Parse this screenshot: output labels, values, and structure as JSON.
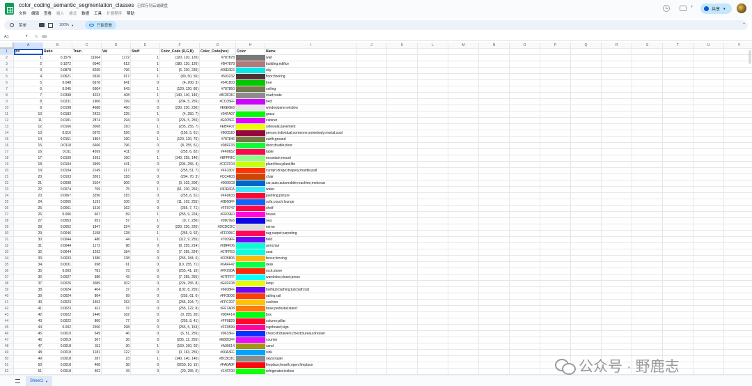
{
  "doc": {
    "title": "color_coding_semantic_segmentation_classes",
    "saved": "已保存到云端硬盘",
    "menus": [
      "文件",
      "编辑",
      "查看",
      "插入",
      "格式",
      "数据",
      "工具",
      "扩展程序",
      "帮助"
    ]
  },
  "toolbar": {
    "search": "菜单",
    "zoom": "100%",
    "view_mode": "只能查看",
    "share": "共享"
  },
  "formula": {
    "cell_ref": "A1",
    "value": "Idx"
  },
  "columns": [
    "A",
    "B",
    "C",
    "D",
    "E",
    "F",
    "G",
    "H",
    "I",
    "J",
    "K",
    "L",
    "M",
    "N",
    "O",
    "P",
    "Q",
    "R",
    "S",
    "T",
    "U",
    "V"
  ],
  "headers": [
    "Idx",
    "Ratio",
    "Train",
    "Val",
    "Stuff",
    "Color_Code (R,G,B)",
    "Color_Code(hex)",
    "Color",
    "Name"
  ],
  "rows": [
    [
      "1",
      "0.1576",
      "11664",
      "1172",
      "1",
      "(120, 120, 120)",
      "#787878",
      "#787878",
      "wall"
    ],
    [
      "2",
      "0.1072",
      "6046",
      "612",
      "1",
      "(180, 120, 120)",
      "#B47878",
      "#B47878",
      "building;edifice"
    ],
    [
      "3",
      "0.0878",
      "8265",
      "796",
      "1",
      "(6, 230, 230)",
      "#06E6E6",
      "#06E6E6",
      "sky"
    ],
    [
      "4",
      "0.0621",
      "9336",
      "917",
      "1",
      "(80, 50, 50)",
      "#503232",
      "#503232",
      "floor;flooring"
    ],
    [
      "5",
      "0.048",
      "6678",
      "641",
      "0",
      "(4, 200, 3)",
      "#04C803",
      "#04C803",
      "tree"
    ],
    [
      "6",
      "0.045",
      "6604",
      "643",
      "1",
      "(120, 120, 80)",
      "#787850",
      "#787850",
      "ceiling"
    ],
    [
      "7",
      "0.0398",
      "4023",
      "408",
      "1",
      "(140, 140, 140)",
      "#8C8C8C",
      "#8C8C8C",
      "road;route"
    ],
    [
      "8",
      "0.0231",
      "1906",
      "199",
      "0",
      "(204, 5, 255)",
      "#CC05FF",
      "#CC05FF",
      "bed"
    ],
    [
      "9",
      "0.0198",
      "4688",
      "460",
      "0",
      "(230, 230, 230)",
      "#E6E6E6",
      "#E6E6E6",
      "windowpane;window"
    ],
    [
      "10",
      "0.0183",
      "2423",
      "225",
      "1",
      "(4, 250, 7)",
      "#04FA07",
      "#04FA07",
      "grass"
    ],
    [
      "11",
      "0.0181",
      "2874",
      "294",
      "0",
      "(224, 5, 255)",
      "#E005FF",
      "#E005FF",
      "cabinet"
    ],
    [
      "12",
      "0.0166",
      "3068",
      "310",
      "1",
      "(235, 255, 7)",
      "#EBFF07",
      "#EBFF07",
      "sidewalk;pavement"
    ],
    [
      "13",
      "0.016",
      "5075",
      "526",
      "0",
      "(150, 5, 61)",
      "#96053D",
      "#96053D",
      "person;individual;someone;somebody;mortal;soul"
    ],
    [
      "14",
      "0.0151",
      "1804",
      "190",
      "1",
      "(120, 120, 70)",
      "#787846",
      "#787846",
      "earth;ground"
    ],
    [
      "15",
      "0.0118",
      "6666",
      "796",
      "0",
      "(8, 255, 51)",
      "#08FF33",
      "#08FF33",
      "door;double;door"
    ],
    [
      "16",
      "0.011",
      "4269",
      "411",
      "0",
      "(255, 6, 82)",
      "#FF0652",
      "#FF0652",
      "table"
    ],
    [
      "17",
      "0.0109",
      "1691",
      "160",
      "1",
      "(143, 255, 140)",
      "#8FFF8C",
      "#8FFF8C",
      "mountain;mount"
    ],
    [
      "18",
      "0.0104",
      "3999",
      "441",
      "0",
      "(204, 255, 4)",
      "#CCFF04",
      "#CCFF04",
      "plant;flora;plant;life"
    ],
    [
      "19",
      "0.0104",
      "2149",
      "217",
      "0",
      "(255, 51, 7)",
      "#FF3307",
      "#FF3307",
      "curtain;drape;drapery;mantle;pall"
    ],
    [
      "20",
      "0.0103",
      "3261",
      "318",
      "0",
      "(204, 70, 3)",
      "#CC4603",
      "#CC4603",
      "chair"
    ],
    [
      "21",
      "0.0098",
      "3164",
      "306",
      "0",
      "(0, 102, 200)",
      "#0066C8",
      "#0066C8",
      "car;auto;automobile;machine;motorcar"
    ],
    [
      "22",
      "0.0074",
      "709",
      "75",
      "1",
      "(61, 230, 250)",
      "#3DE6FA",
      "#3DE6FA",
      "water"
    ],
    [
      "23",
      "0.0067",
      "3296",
      "315",
      "0",
      "(255, 6, 51)",
      "#FF0633",
      "#FF0633",
      "painting;picture"
    ],
    [
      "24",
      "0.0065",
      "1191",
      "106",
      "0",
      "(11, 102, 255)",
      "#0B66FF",
      "#0B66FF",
      "sofa;couch;lounge"
    ],
    [
      "25",
      "0.0061",
      "1516",
      "162",
      "0",
      "(255, 7, 71)",
      "#FF0747",
      "#FF0747",
      "shelf"
    ],
    [
      "26",
      "0.006",
      "667",
      "69",
      "1",
      "(255, 9, 224)",
      "#FF09E0",
      "#FF09E0",
      "house"
    ],
    [
      "27",
      "0.0053",
      "651",
      "57",
      "1",
      "(9, 7, 230)",
      "#0907E6",
      "#0907E6",
      "sea"
    ],
    [
      "28",
      "0.0052",
      "1847",
      "224",
      "0",
      "(220, 220, 220)",
      "#DCDCDC",
      "#DCDCDC",
      "mirror"
    ],
    [
      "29",
      "0.0046",
      "1158",
      "128",
      "1",
      "(255, 9, 92)",
      "#FF095C",
      "#FF095C",
      "rug;carpet;carpeting"
    ],
    [
      "30",
      "0.0044",
      "480",
      "44",
      "1",
      "(112, 9, 255)",
      "#7009FF",
      "#7009FF",
      "field"
    ],
    [
      "31",
      "0.0044",
      "1172",
      "98",
      "0",
      "(8, 255, 214)",
      "#08FFD6",
      "#08FFD6",
      "armchair"
    ],
    [
      "32",
      "0.0044",
      "1292",
      "184",
      "0",
      "(7, 255, 224)",
      "#07FFE0",
      "#07FFE0",
      "seat"
    ],
    [
      "33",
      "0.0033",
      "1386",
      "138",
      "0",
      "(255, 184, 6)",
      "#FFB806",
      "#FFB806",
      "fence;fencing"
    ],
    [
      "34",
      "0.0031",
      "698",
      "61",
      "0",
      "(10, 255, 71)",
      "#0AFF47",
      "#0AFF47",
      "desk"
    ],
    [
      "35",
      "0.003",
      "781",
      "73",
      "0",
      "(255, 41, 10)",
      "#FF290A",
      "#FF290A",
      "rock;stone"
    ],
    [
      "36",
      "0.0027",
      "380",
      "43",
      "0",
      "(7, 255, 255)",
      "#07FFFF",
      "#07FFFF",
      "wardrobe;closet;press"
    ],
    [
      "37",
      "0.0026",
      "3089",
      "302",
      "0",
      "(224, 255, 8)",
      "#E0FF08",
      "#E0FF08",
      "lamp"
    ],
    [
      "38",
      "0.0024",
      "404",
      "37",
      "0",
      "(102, 8, 255)",
      "#6608FF",
      "#6608FF",
      "bathtub;bathing;tub;bath;tub"
    ],
    [
      "39",
      "0.0024",
      "804",
      "99",
      "0",
      "(255, 61, 6)",
      "#FF3D06",
      "#FF3D06",
      "railing;rail"
    ],
    [
      "40",
      "0.0023",
      "1453",
      "153",
      "0",
      "(255, 194, 7)",
      "#FFC207",
      "#FFC207",
      "cushion"
    ],
    [
      "41",
      "0.0023",
      "411",
      "37",
      "0",
      "(255, 122, 8)",
      "#FF7A08",
      "#FF7A08",
      "base;pedestal;stand"
    ],
    [
      "42",
      "0.0022",
      "1440",
      "162",
      "0",
      "(0, 255, 20)",
      "#00FF14",
      "#00FF14",
      "box"
    ],
    [
      "43",
      "0.0022",
      "800",
      "77",
      "0",
      "(255, 8, 41)",
      "#FF0829",
      "#FF0829",
      "column;pillar"
    ],
    [
      "44",
      "0.002",
      "2650",
      "298",
      "0",
      "(255, 5, 153)",
      "#FF0599",
      "#FF0599",
      "signboard;sign"
    ],
    [
      "45",
      "0.0019",
      "549",
      "46",
      "0",
      "(6, 51, 255)",
      "#0633FF",
      "#0633FF",
      "chest;of;drawers;chest;bureau;dresser"
    ],
    [
      "46",
      "0.0019",
      "367",
      "36",
      "0",
      "(235, 12, 255)",
      "#EB0CFF",
      "#EB0CFF",
      "counter"
    ],
    [
      "47",
      "0.0018",
      "311",
      "30",
      "1",
      "(160, 150, 20)",
      "#A09614",
      "#A09614",
      "sand"
    ],
    [
      "48",
      "0.0018",
      "1181",
      "122",
      "0",
      "(0, 163, 255)",
      "#00A3FF",
      "#00A3FF",
      "sink"
    ],
    [
      "49",
      "0.0018",
      "287",
      "23",
      "1",
      "(140, 140, 140)",
      "#8C8C8C",
      "#8C8C8C",
      "skyscraper"
    ],
    [
      "50",
      "0.0018",
      "468",
      "38",
      "0",
      "(0250, 10, 15)",
      "#FA0A0F",
      "#FA0A0F",
      "fireplace;hearth;open;fireplace"
    ],
    [
      "51",
      "0.0018",
      "402",
      "43",
      "0",
      "(20, 255, 0)",
      "#14FF00",
      "#14FF00",
      "refrigerator;icebox"
    ]
  ],
  "sheet_tab": "Sheet1",
  "watermark": "公众号 · 野鹿志"
}
